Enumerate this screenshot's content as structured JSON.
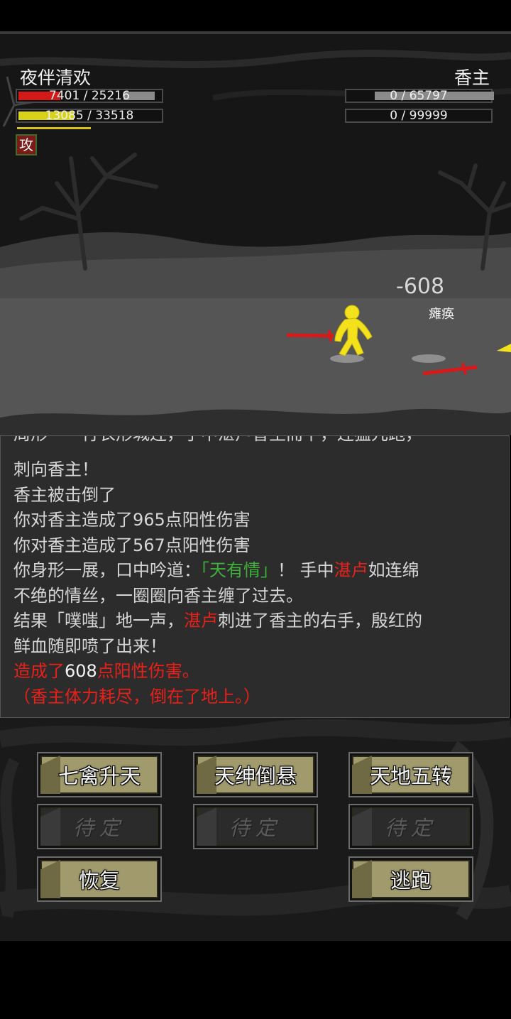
{
  "player": {
    "name": "夜伴清欢",
    "hp_text": "7401 / 25216",
    "hp_fraction": 0.2935,
    "mp_text": "13085 / 33518",
    "mp_fraction": 0.3904,
    "buff_label": "攻",
    "hp_color": "#d41a17",
    "mp_color": "#d8d21a"
  },
  "enemy": {
    "name": "香主",
    "hp_text": "0 / 65797",
    "mp_text": "0 / 99999",
    "damage_popup": "-608",
    "status_popup": "瘫痪"
  },
  "log": {
    "cut_line": "周形一一行衣形城连，手中湛卢香主而下，连猛冗跑，",
    "lines": [
      [
        {
          "t": "刺向香主！",
          "c": ""
        }
      ],
      [
        {
          "t": "香主被击倒了",
          "c": ""
        }
      ],
      [
        {
          "t": "你对香主造成了965点阳性伤害",
          "c": ""
        }
      ],
      [
        {
          "t": "你对香主造成了567点阳性伤害",
          "c": ""
        }
      ],
      [
        {
          "t": "你身形一展，口中吟道：",
          "c": ""
        },
        {
          "t": "「天有情」",
          "c": "green"
        },
        {
          "t": "！ 手中",
          "c": ""
        },
        {
          "t": "湛卢",
          "c": "red"
        },
        {
          "t": "如连绵",
          "c": ""
        }
      ],
      [
        {
          "t": "不绝的情丝，一圈圈向香主缠了过去。",
          "c": ""
        }
      ],
      [
        {
          "t": "结果「噗嗤」地一声，",
          "c": ""
        },
        {
          "t": "湛卢",
          "c": "red"
        },
        {
          "t": "刺进了香主的右手，殷红的",
          "c": ""
        }
      ],
      [
        {
          "t": "鲜血随即喷了出来！",
          "c": ""
        }
      ],
      [
        {
          "t": "造成了",
          "c": "red"
        },
        {
          "t": "608",
          "c": "white"
        },
        {
          "t": "点阳性伤害。",
          "c": "red"
        }
      ],
      [
        {
          "t": "（香主体力耗尽，倒在了地上。）",
          "c": "red"
        }
      ]
    ]
  },
  "skills": {
    "row1": [
      "七禽升天",
      "天绅倒悬",
      "天地五转"
    ],
    "pending": "待定",
    "recover": "恢复",
    "flee": "逃跑"
  }
}
